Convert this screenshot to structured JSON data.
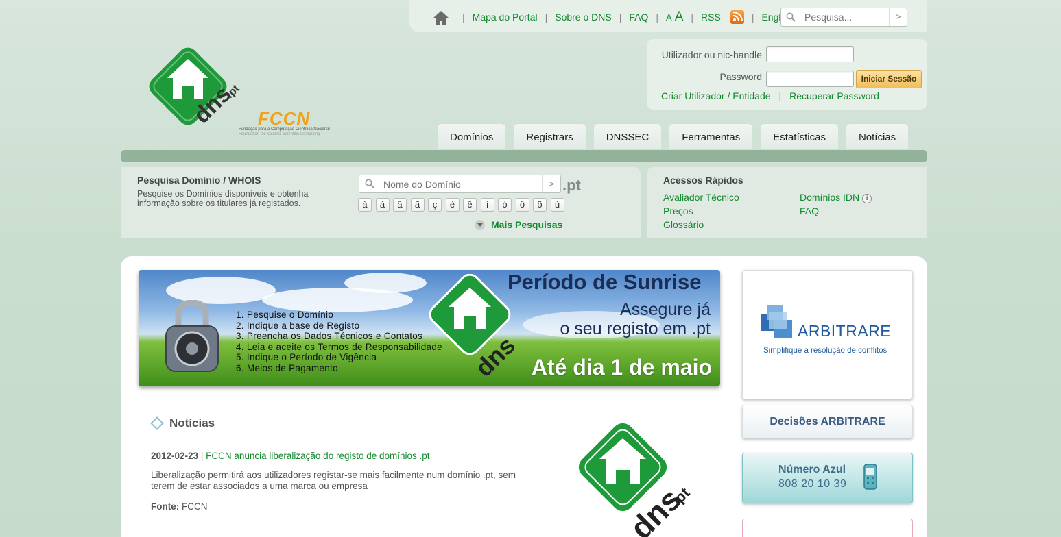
{
  "topbar": {
    "links": [
      "Mapa do Portal",
      "Sobre o DNS",
      "FAQ"
    ],
    "font_small": "A",
    "font_large": "A",
    "rss": "RSS",
    "english": "English",
    "search_placeholder": "Pesquisa..."
  },
  "fccn": {
    "word": "FCCN",
    "sub1": "Fundação para a Computação Científica Nacional",
    "sub2": "Foundation for National Scientific Computing"
  },
  "logo": {
    "text": "dns.pt"
  },
  "login": {
    "user_label": "Utilizador ou nic-handle",
    "password_label": "Password",
    "submit": "Iniciar Sessão",
    "create": "Criar Utilizador / Entidade",
    "recover": "Recuperar Password"
  },
  "tabs": [
    "Domínios",
    "Registrars",
    "DNSSEC",
    "Ferramentas",
    "Estatísticas",
    "Notícias"
  ],
  "search_panel": {
    "title": "Pesquisa Domínio / WHOIS",
    "description": "Pesquise os Domínios disponíveis e obtenha informação sobre os titulares já registados.",
    "placeholder": "Nome do Domínio",
    "tld": ".pt",
    "chars": [
      "à",
      "á",
      "â",
      "ã",
      "ç",
      "é",
      "ê",
      "í",
      "ó",
      "ô",
      "õ",
      "ú"
    ],
    "more": "Mais Pesquisas"
  },
  "quick": {
    "title": "Acessos Rápidos",
    "col1": [
      "Avaliador Técnico",
      "Preços",
      "Glossário"
    ],
    "col2": [
      "Domínios IDN",
      "FAQ"
    ]
  },
  "banner": {
    "title": "Período de Sunrise",
    "sub_line1": "Assegure já",
    "sub_line2": "o seu registo em .pt",
    "date": "Até dia 1 de maio",
    "steps": [
      "1. Pesquise o Domínio",
      "2. Indique a base de Registo",
      "3. Preencha os Dados Técnicos e Contatos",
      "4. Leia e aceite os Termos de Responsabilidade",
      "5. Indique o Período de Vigência",
      "6. Meios de Pagamento"
    ]
  },
  "news": {
    "heading": "Notícias",
    "date": "2012-02-23",
    "title": "FCCN anuncia liberalização do registo de domínios .pt",
    "body": "Liberalização permitirá aos utilizadores registar-se mais facilmente num domínio .pt, sem terem de estar associados a uma marca ou empresa",
    "source_label": "Fonte:",
    "source": "FCCN"
  },
  "sidebar": {
    "arbitrare_name": "ARBITRARE",
    "arbitrare_slogan": "Simplifique a resolução de conflitos",
    "decisions": "Decisões ARBITRARE",
    "azul_title": "Número Azul",
    "azul_number": "808 20 10 39"
  },
  "colors": {
    "link_green": "#13892e",
    "logo_green": "#1f9a3a",
    "fccn_orange": "#f0a31a",
    "arbitrare_blue": "#1f5a9d"
  }
}
